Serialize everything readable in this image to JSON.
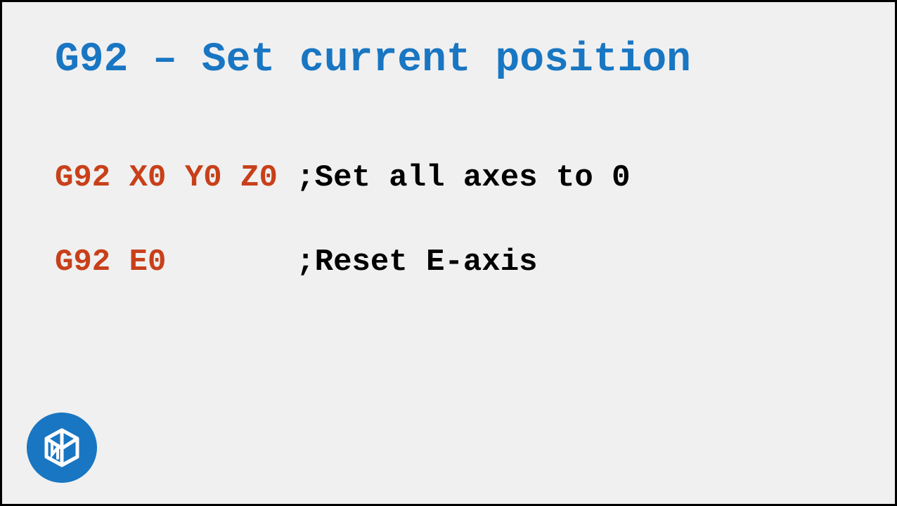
{
  "title": "G92 – Set current position",
  "lines": [
    {
      "cmd": "G92 X0 Y0 Z0 ",
      "comment": ";Set all axes to 0"
    },
    {
      "cmd": "G92 E0       ",
      "comment": ";Reset E-axis"
    }
  ],
  "colors": {
    "title": "#1976c2",
    "command": "#c8401a",
    "comment": "#000000",
    "logo_bg": "#1976c2"
  }
}
